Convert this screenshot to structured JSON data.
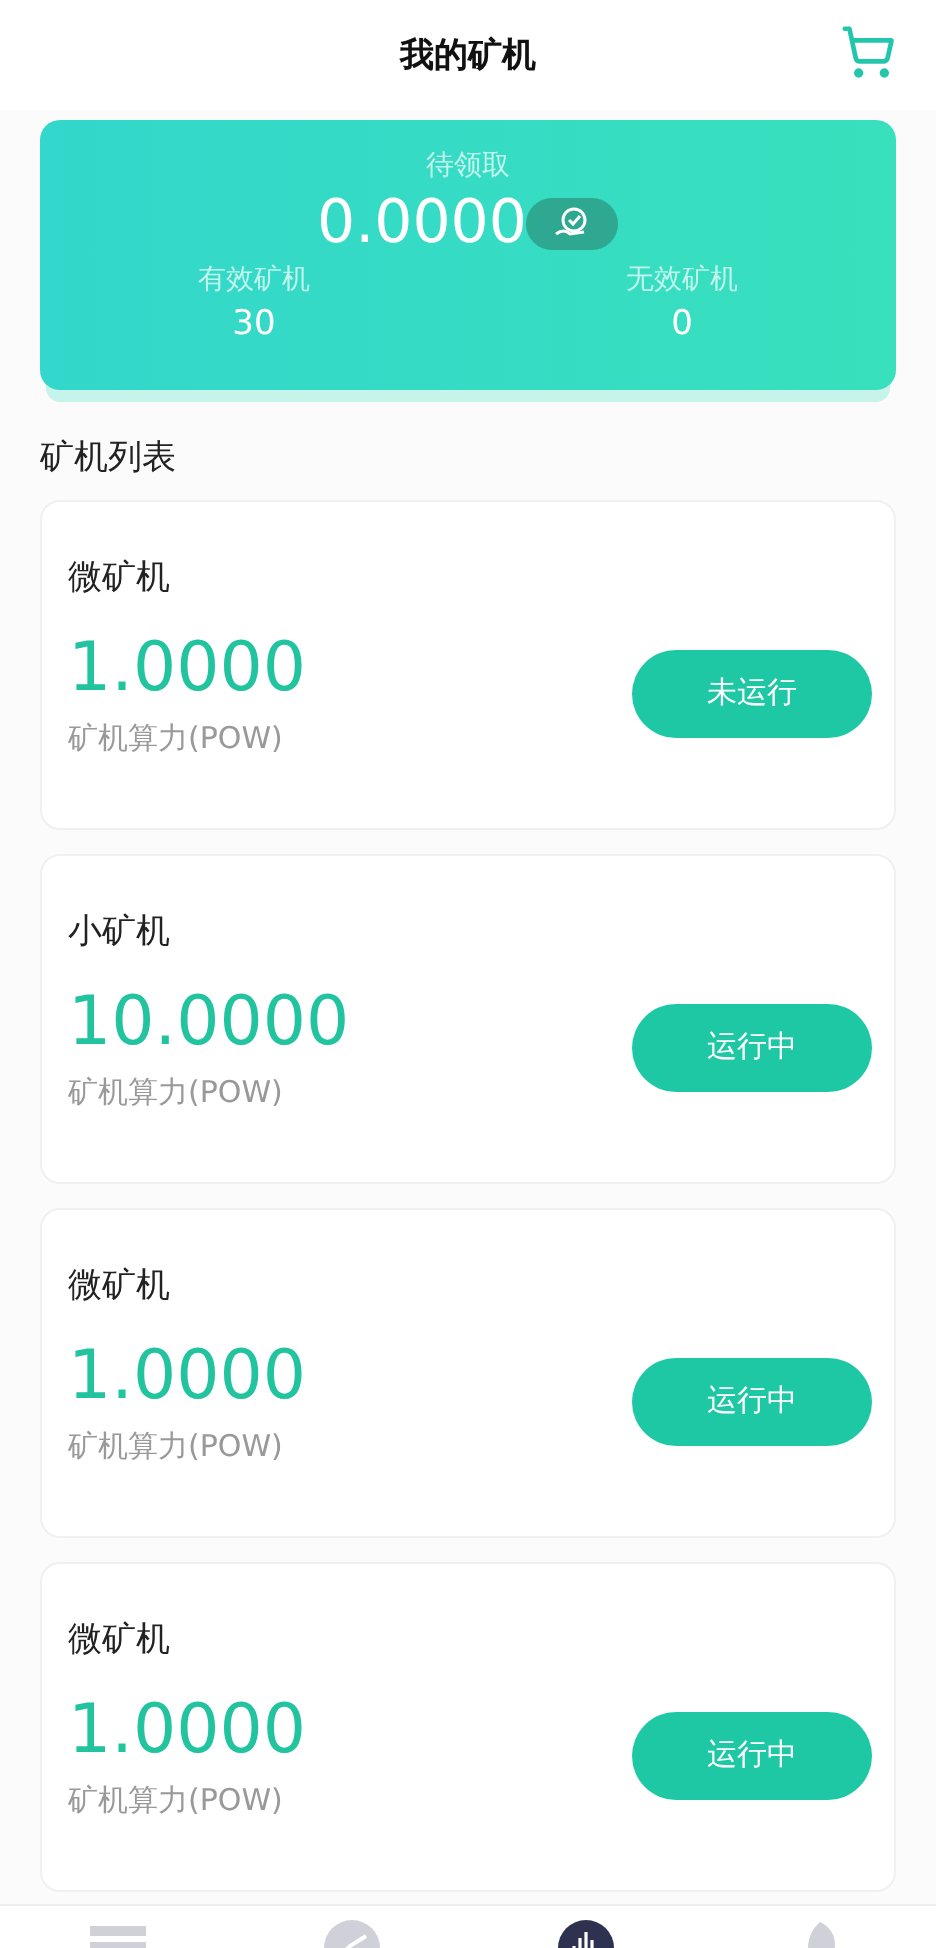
{
  "header": {
    "title": "我的矿机"
  },
  "summary": {
    "pending_label": "待领取",
    "pending_value": "0.0000",
    "stats": [
      {
        "label": "有效矿机",
        "value": "30"
      },
      {
        "label": "无效矿机",
        "value": "0"
      }
    ]
  },
  "section_title": "矿机列表",
  "machines": [
    {
      "name": "微矿机",
      "power": "1.0000",
      "power_label": "矿机算力(POW)",
      "action": "未运行"
    },
    {
      "name": "小矿机",
      "power": "10.0000",
      "power_label": "矿机算力(POW)",
      "action": "运行中"
    },
    {
      "name": "微矿机",
      "power": "1.0000",
      "power_label": "矿机算力(POW)",
      "action": "运行中"
    },
    {
      "name": "微矿机",
      "power": "1.0000",
      "power_label": "矿机算力(POW)",
      "action": "运行中"
    }
  ],
  "nav": [
    {
      "kind": "list",
      "selected": false
    },
    {
      "kind": "trend",
      "selected": false
    },
    {
      "kind": "chart",
      "selected": true
    },
    {
      "kind": "leaf",
      "selected": false
    }
  ]
}
